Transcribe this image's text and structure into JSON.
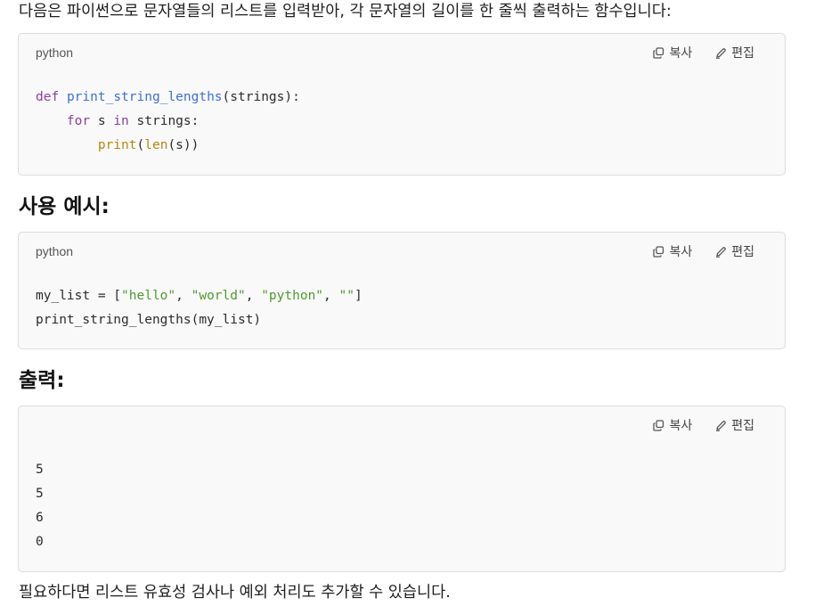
{
  "intro": "다음은 파이썬으로 문자열들의 리스트를 입력받아, 각 문자열의 길이를 한 줄씩 출력하는 함수입니다:",
  "actions": {
    "copy_label": "복사",
    "edit_label": "편집",
    "copy_icon": "copy-icon",
    "edit_icon": "pencil-icon"
  },
  "block1": {
    "language": "python",
    "line1": {
      "kw": "def",
      "fn": "print_string_lengths",
      "rest": "(strings):"
    },
    "line2": {
      "indent": "    ",
      "kw1": "for",
      "mid": " s ",
      "kw2": "in",
      "rest": " strings:"
    },
    "line3": {
      "indent": "        ",
      "bi1": "print",
      "p1": "(",
      "bi2": "len",
      "rest": "(s))"
    }
  },
  "heading_usage": "사용 예시:",
  "block2": {
    "language": "python",
    "line1": {
      "prefix": "my_list = [",
      "s1": "\"hello\"",
      "sep1": ", ",
      "s2": "\"world\"",
      "sep2": ", ",
      "s3": "\"python\"",
      "sep3": ", ",
      "s4": "\"\"",
      "suffix": "]"
    },
    "line2": "print_string_lengths(my_list)"
  },
  "heading_output": "출력:",
  "block3": {
    "lines": [
      "5",
      "5",
      "6",
      "0"
    ]
  },
  "outro": "필요하다면 리스트 유효성 검사나 예외 처리도 추가할 수 있습니다.",
  "colors": {
    "keyword": "#8a3fa0",
    "function": "#3d6fd6",
    "builtin": "#b8860b",
    "string": "#4e9a2f",
    "code_bg": "#f9f9f9"
  }
}
